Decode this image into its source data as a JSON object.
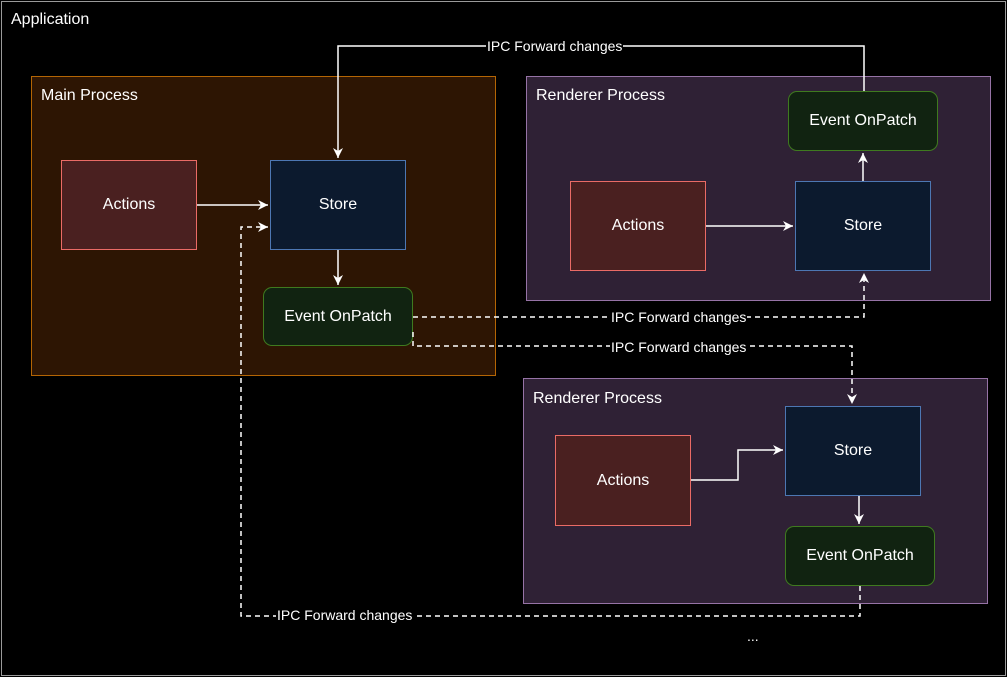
{
  "application": {
    "title": "Application"
  },
  "main_process": {
    "title": "Main Process",
    "actions": "Actions",
    "store": "Store",
    "event": "Event OnPatch"
  },
  "renderer_1": {
    "title": "Renderer Process",
    "actions": "Actions",
    "store": "Store",
    "event": "Event OnPatch"
  },
  "renderer_2": {
    "title": "Renderer Process",
    "actions": "Actions",
    "store": "Store",
    "event": "Event OnPatch"
  },
  "edge_labels": {
    "top": "IPC Forward changes",
    "main_to_r1": "IPC Forward changes",
    "main_to_r2": "IPC Forward changes",
    "r2_to_main": "IPC Forward changes"
  },
  "ellipsis": "...",
  "colors": {
    "main_fill": "#2d1503",
    "main_stroke": "#b46504",
    "renderer_fill": "#2f2135",
    "renderer_stroke": "#9673a6",
    "actions_fill": "#4a2020",
    "actions_stroke": "#ea6b66",
    "store_fill": "#0c1a2e",
    "store_stroke": "#4d77b3",
    "event_fill": "#112311",
    "event_stroke": "#3f7a1f"
  }
}
